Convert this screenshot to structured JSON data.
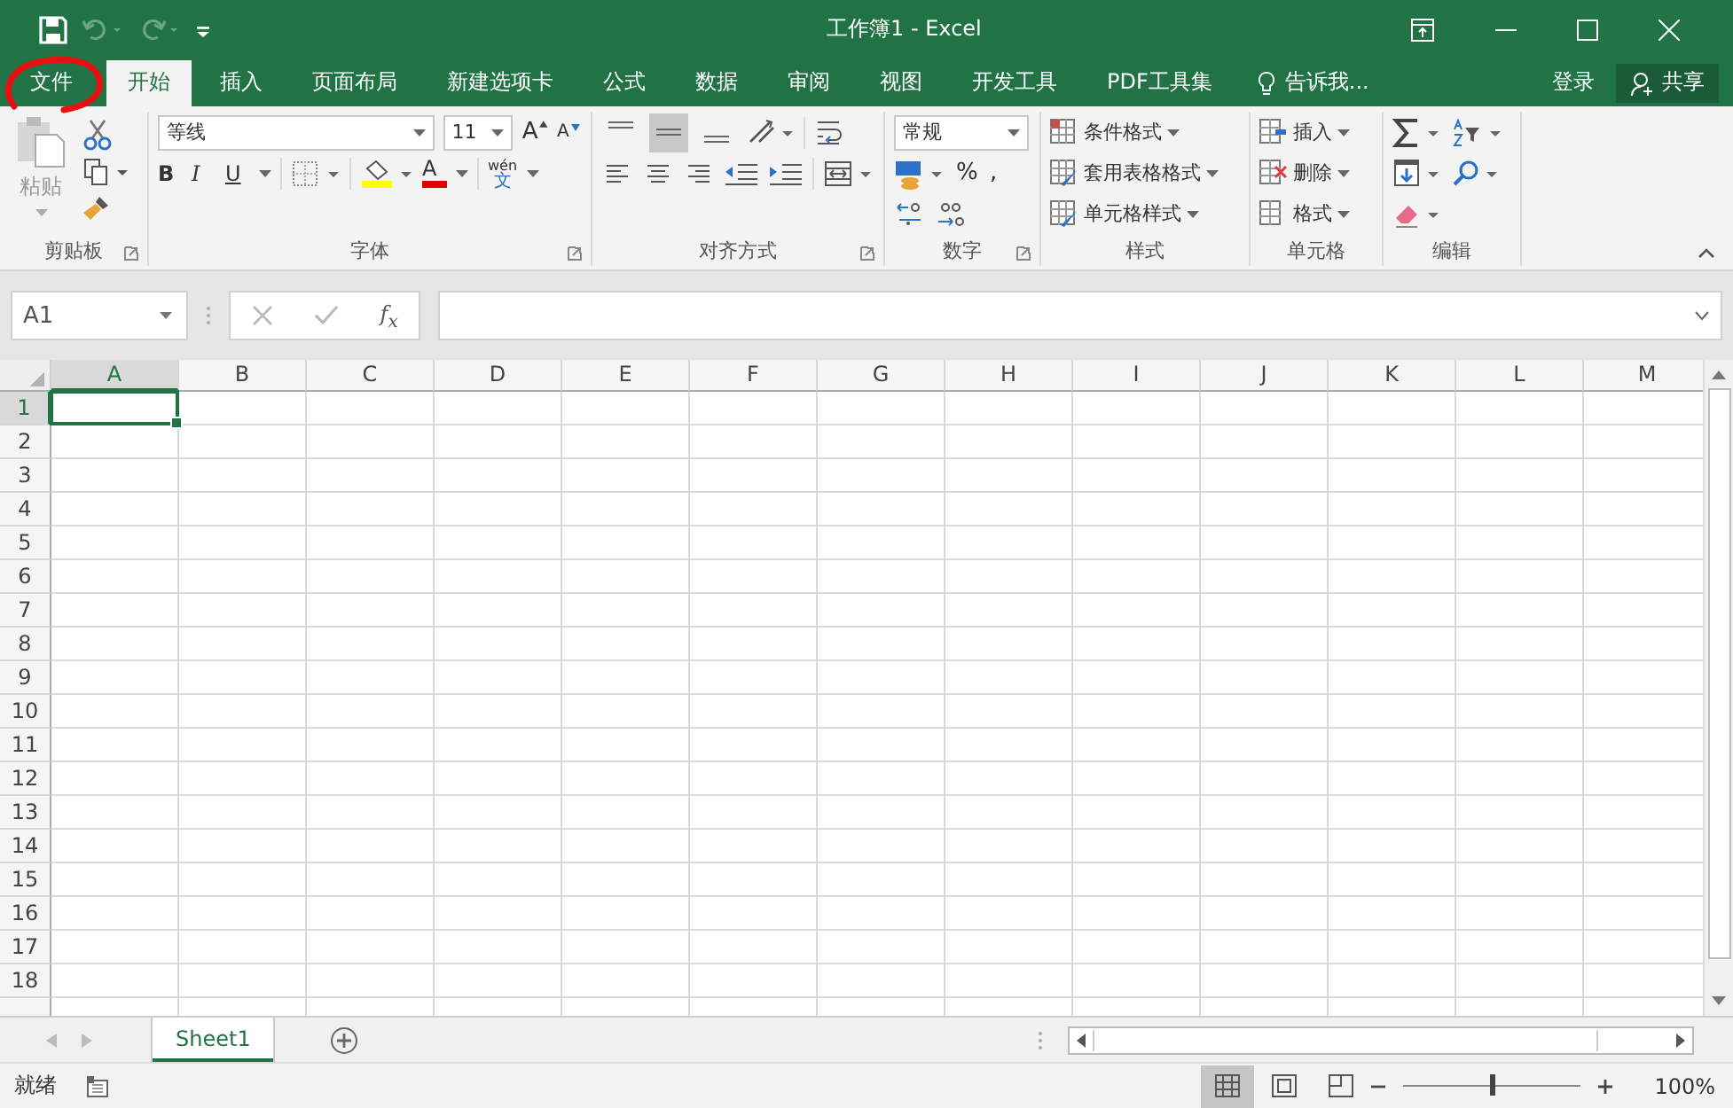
{
  "title_bar": {
    "title": "工作簿1 - Excel"
  },
  "ribbon_tabs": [
    {
      "label": "文件",
      "selected": false,
      "circled": true
    },
    {
      "label": "开始",
      "selected": true,
      "circled": false
    },
    {
      "label": "插入",
      "selected": false,
      "circled": false
    },
    {
      "label": "页面布局",
      "selected": false,
      "circled": false
    },
    {
      "label": "新建选项卡",
      "selected": false,
      "circled": false
    },
    {
      "label": "公式",
      "selected": false,
      "circled": false
    },
    {
      "label": "数据",
      "selected": false,
      "circled": false
    },
    {
      "label": "审阅",
      "selected": false,
      "circled": false
    },
    {
      "label": "视图",
      "selected": false,
      "circled": false
    },
    {
      "label": "开发工具",
      "selected": false,
      "circled": false
    },
    {
      "label": "PDF工具集",
      "selected": false,
      "circled": false
    }
  ],
  "tell_me": "告诉我...",
  "sign_in": "登录",
  "share": "共享",
  "clipboard": {
    "paste": "粘贴",
    "label": "剪贴板"
  },
  "font": {
    "name": "等线",
    "size": "11",
    "grow": "A",
    "shrink": "A",
    "styles": [
      "B",
      "I",
      "U"
    ],
    "color_letter": "A",
    "phonetic_top": "wén",
    "phonetic_bottom": "文",
    "label": "字体"
  },
  "alignment": {
    "label": "对齐方式"
  },
  "number": {
    "format": "常规",
    "symbols": [
      "%",
      ","
    ],
    "label": "数字"
  },
  "styles": {
    "items": [
      "条件格式",
      "套用表格格式",
      "单元格样式"
    ],
    "label": "样式"
  },
  "cells": {
    "items": [
      "插入",
      "删除",
      "格式"
    ],
    "label": "单元格"
  },
  "editing": {
    "label": "编辑"
  },
  "formula_bar": {
    "name_box": "A1",
    "function_label": "f$_{x}$"
  },
  "grid": {
    "columns": [
      {
        "label": "A",
        "selected": true
      },
      {
        "label": "B",
        "selected": false
      },
      {
        "label": "C",
        "selected": false
      },
      {
        "label": "D",
        "selected": false
      },
      {
        "label": "E",
        "selected": false
      },
      {
        "label": "F",
        "selected": false
      },
      {
        "label": "G",
        "selected": false
      },
      {
        "label": "H",
        "selected": false
      },
      {
        "label": "I",
        "selected": false
      },
      {
        "label": "J",
        "selected": false
      },
      {
        "label": "K",
        "selected": false
      },
      {
        "label": "L",
        "selected": false
      },
      {
        "label": "M",
        "selected": false
      }
    ],
    "rows": [
      {
        "label": "1",
        "selected": true
      },
      {
        "label": "2",
        "selected": false
      },
      {
        "label": "3",
        "selected": false
      },
      {
        "label": "4",
        "selected": false
      },
      {
        "label": "5",
        "selected": false
      },
      {
        "label": "6",
        "selected": false
      },
      {
        "label": "7",
        "selected": false
      },
      {
        "label": "8",
        "selected": false
      },
      {
        "label": "9",
        "selected": false
      },
      {
        "label": "10",
        "selected": false
      },
      {
        "label": "11",
        "selected": false
      },
      {
        "label": "12",
        "selected": false
      },
      {
        "label": "13",
        "selected": false
      },
      {
        "label": "14",
        "selected": false
      },
      {
        "label": "15",
        "selected": false
      },
      {
        "label": "16",
        "selected": false
      },
      {
        "label": "17",
        "selected": false
      },
      {
        "label": "18",
        "selected": false
      }
    ]
  },
  "sheet_tabs": [
    {
      "label": "Sheet1",
      "selected": true
    }
  ],
  "status_bar": {
    "status": "就绪",
    "zoom": "100%",
    "zoom_slider": {
      "level": 0.5
    },
    "views": [
      {
        "kind": "normal",
        "selected": true
      },
      {
        "kind": "page-layout",
        "selected": false
      },
      {
        "kind": "page-break",
        "selected": false
      }
    ]
  }
}
